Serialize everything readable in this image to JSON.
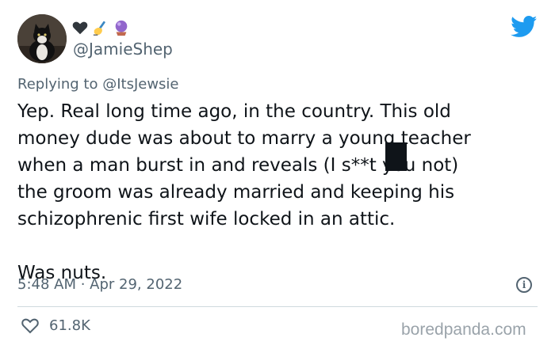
{
  "tweet": {
    "handle": "@JamieShep",
    "replying_to": "Replying to @ItsJewsie",
    "text": "Yep. Real long time ago, in the country. This old\nmoney dude was about to marry a young teacher\nwhen a man burst in and reveals (I s**t you not)\nthe groom was already married and keeping his\nschizophrenic first wife locked in an attic.\n\nWas nuts.",
    "timestamp": "5:48 AM · Apr 29, 2022",
    "likes": "61.8K"
  },
  "icons": {
    "name_emojis": [
      "black-heart-icon",
      "writing-hand-icon",
      "crystal-ball-icon"
    ],
    "brand": "twitter-bird-icon",
    "info": "info-icon",
    "like": "heart-outline-icon"
  },
  "colors": {
    "twitter_blue": "#1d9bf0",
    "secondary_text": "#536471",
    "primary_text": "#0f1419"
  },
  "watermark": "boredpanda.com"
}
